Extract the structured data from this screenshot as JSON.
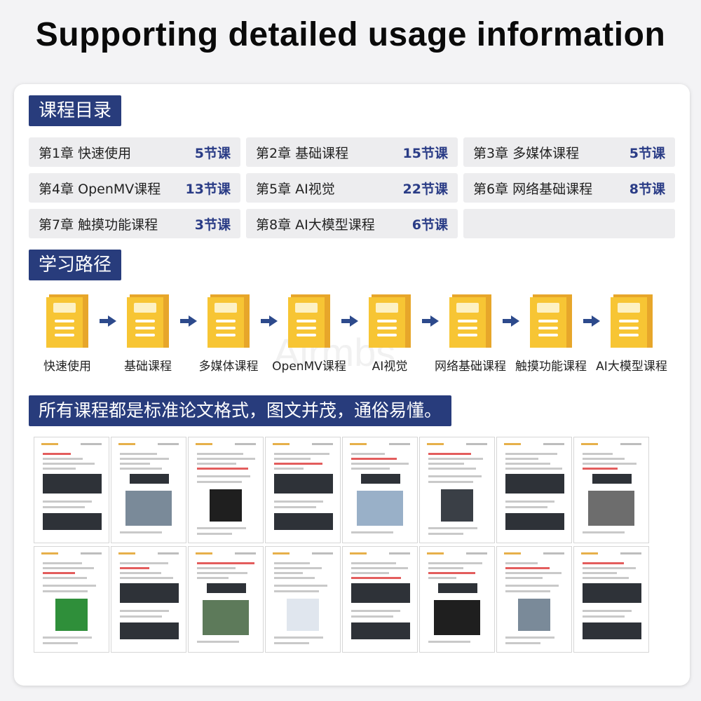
{
  "headline": "Supporting detailed usage information",
  "sections": {
    "catalog": "课程目录",
    "path": "学习路径",
    "format": "所有课程都是标准论文格式，图文并茂，通俗易懂。"
  },
  "chapters": [
    {
      "name": "第1章 快速使用",
      "count": "5节课"
    },
    {
      "name": "第2章 基础课程",
      "count": "15节课"
    },
    {
      "name": "第3章 多媒体课程",
      "count": "5节课"
    },
    {
      "name": "第4章 OpenMV课程",
      "count": "13节课"
    },
    {
      "name": "第5章 AI视觉",
      "count": "22节课"
    },
    {
      "name": "第6章 网络基础课程",
      "count": "8节课"
    },
    {
      "name": "第7章 触摸功能课程",
      "count": "3节课"
    },
    {
      "name": "第8章 AI大模型课程",
      "count": "6节课"
    },
    {
      "name": "",
      "count": ""
    }
  ],
  "path_steps": [
    "快速使用",
    "基础课程",
    "多媒体课程",
    "OpenMV课程",
    "AI视觉",
    "网络基础课程",
    "触摸功能课程",
    "AI大模型课程"
  ],
  "watermark": "Airmbs",
  "colors": {
    "tag_bg": "#283c7c",
    "count_text": "#2a3c86",
    "folder_front": "#f7c534",
    "folder_back": "#e7a62a",
    "arrow": "#2d4a8c",
    "cell_bg": "#ededef"
  },
  "icons": {
    "step": "folder-document-icon",
    "arrow": "right-arrow-icon"
  }
}
